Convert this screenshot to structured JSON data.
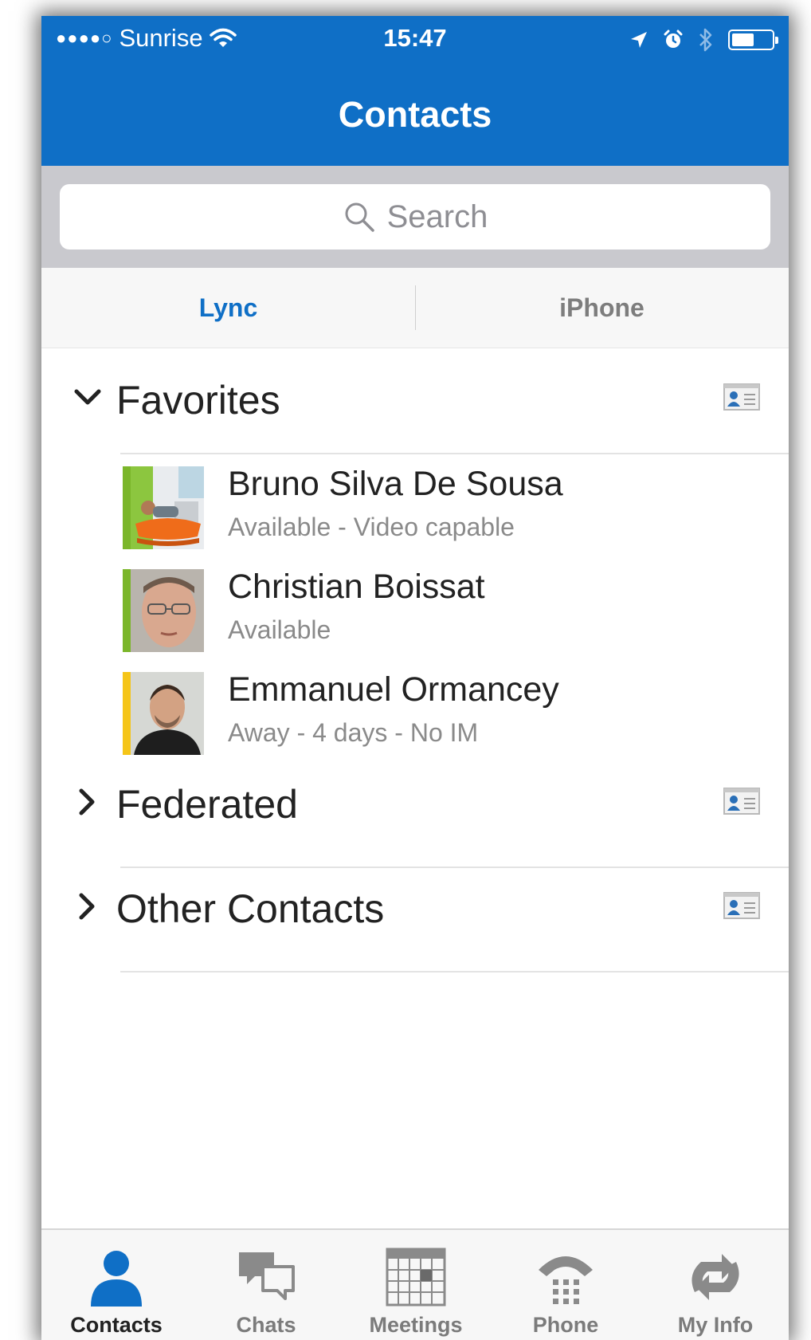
{
  "status_bar": {
    "signal": "●●●●○",
    "carrier": "Sunrise",
    "time": "15:47"
  },
  "nav": {
    "title": "Contacts"
  },
  "search": {
    "placeholder": "Search"
  },
  "segments": {
    "left": "Lync",
    "right": "iPhone",
    "selected": "Lync"
  },
  "groups": [
    {
      "name": "Favorites",
      "expanded": true,
      "contacts": [
        {
          "name": "Bruno Silva De Sousa",
          "status": "Available - Video capable",
          "presence_color": "#7bb62a"
        },
        {
          "name": "Christian Boissat",
          "status": "Available",
          "presence_color": "#7bb62a"
        },
        {
          "name": "Emmanuel Ormancey",
          "status": "Away - 4 days - No IM",
          "presence_color": "#f5c518"
        }
      ]
    },
    {
      "name": "Federated",
      "expanded": false
    },
    {
      "name": "Other Contacts",
      "expanded": false
    }
  ],
  "tabbar": {
    "items": [
      {
        "label": "Contacts",
        "icon": "person-icon",
        "active": true
      },
      {
        "label": "Chats",
        "icon": "chat-bubbles-icon"
      },
      {
        "label": "Meetings",
        "icon": "calendar-icon"
      },
      {
        "label": "Phone",
        "icon": "phone-icon"
      },
      {
        "label": "My Info",
        "icon": "sync-icon"
      }
    ]
  },
  "colors": {
    "accent": "#0f6fc6",
    "available": "#7bb62a",
    "away": "#f5c518"
  }
}
